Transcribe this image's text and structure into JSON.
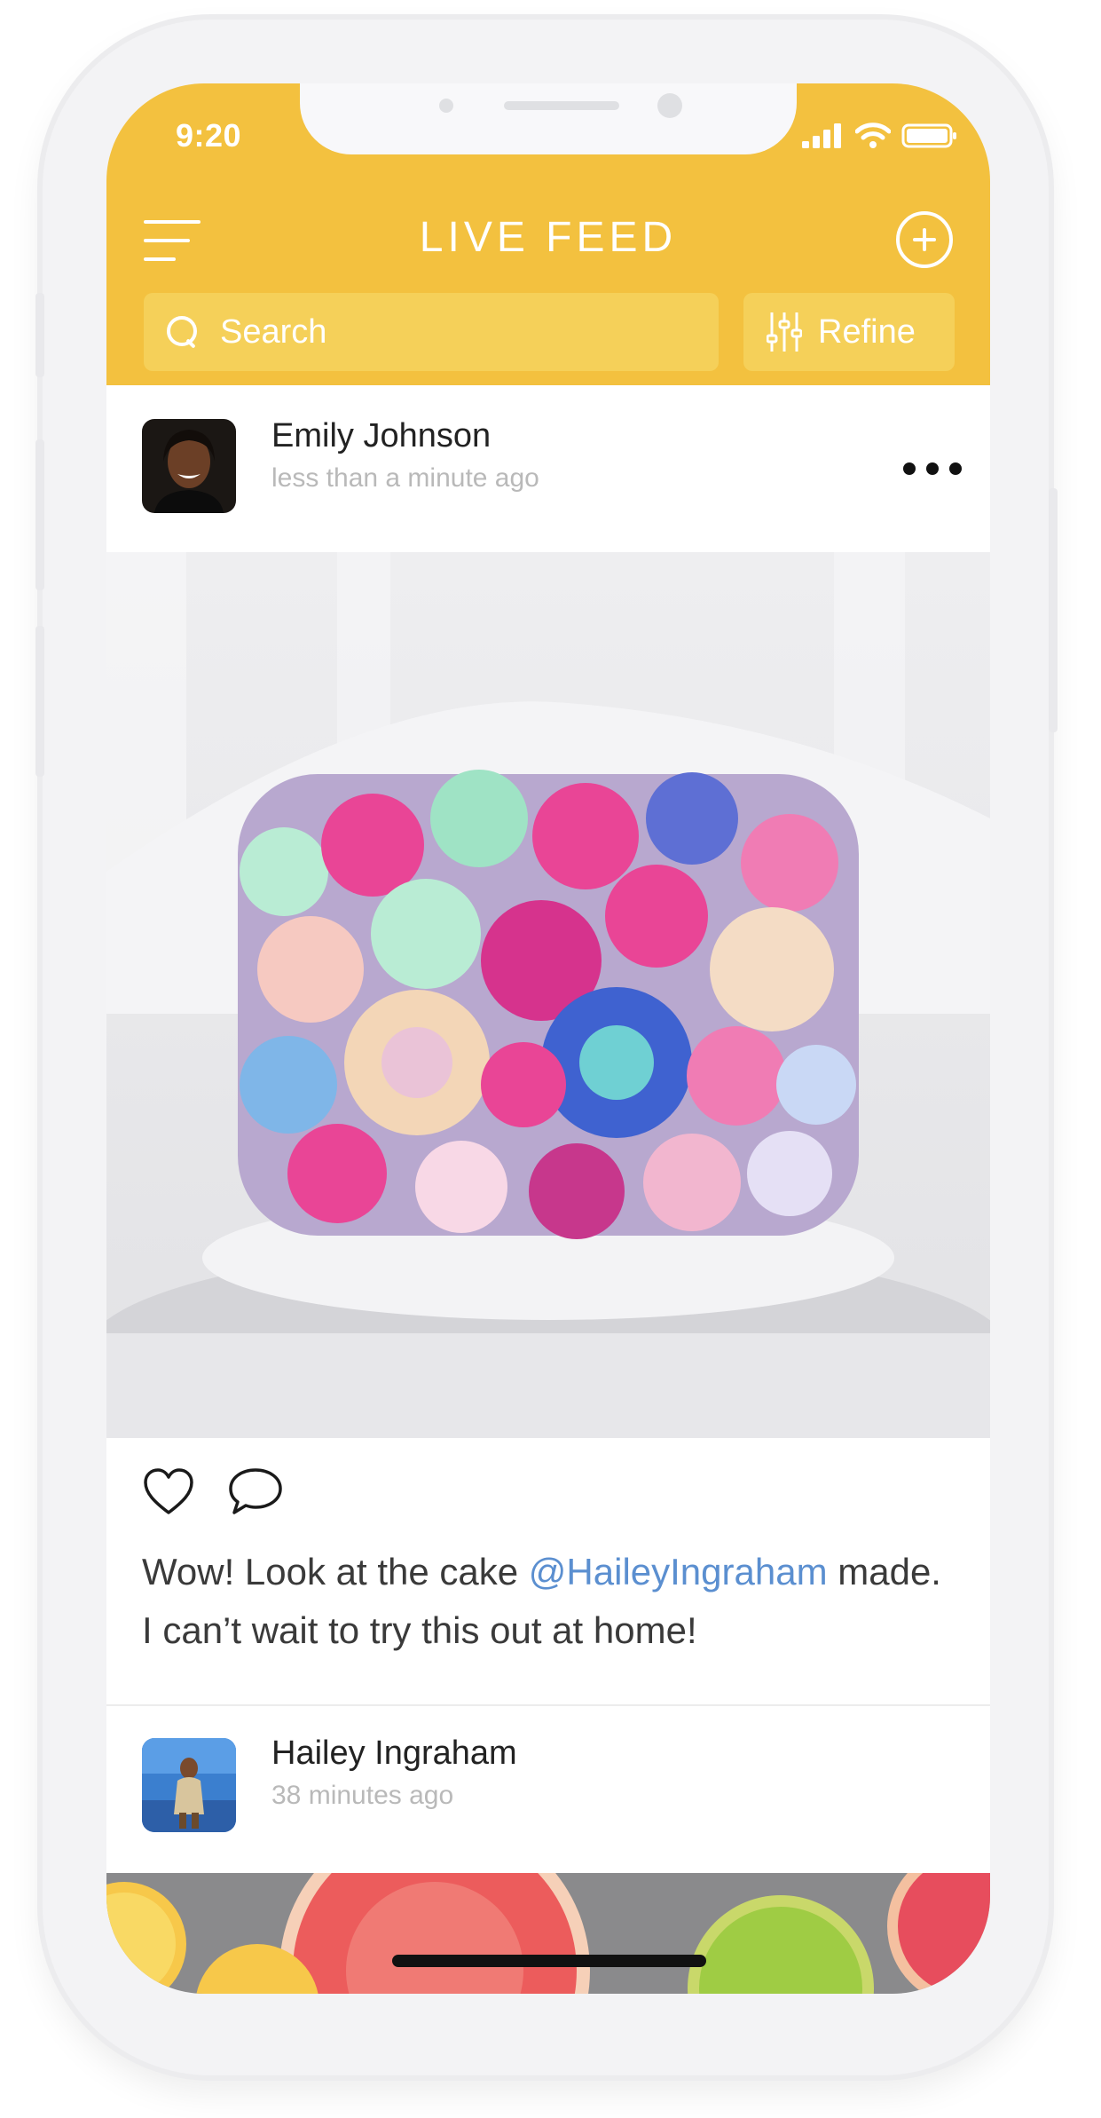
{
  "status_bar": {
    "time": "9:20"
  },
  "header": {
    "title": "LIVE FEED",
    "search_placeholder": "Search",
    "refine_label": "Refine"
  },
  "posts": [
    {
      "user_name": "Emily Johnson",
      "time_ago": "less than a minute ago",
      "caption_before": "Wow! Look at the cake ",
      "mention": "@HaileyIngraham",
      "caption_after": " made. I can’t wait to try this out at home!"
    },
    {
      "user_name": "Hailey Ingraham",
      "time_ago": "38 minutes ago"
    }
  ],
  "colors": {
    "header_background": "#f3c13f",
    "search_background": "#f5d059",
    "mention": "#5b8fd0"
  },
  "icons": [
    "menu-icon",
    "add-icon",
    "search-icon",
    "refine-icon",
    "more-icon",
    "heart-icon",
    "comment-icon"
  ]
}
